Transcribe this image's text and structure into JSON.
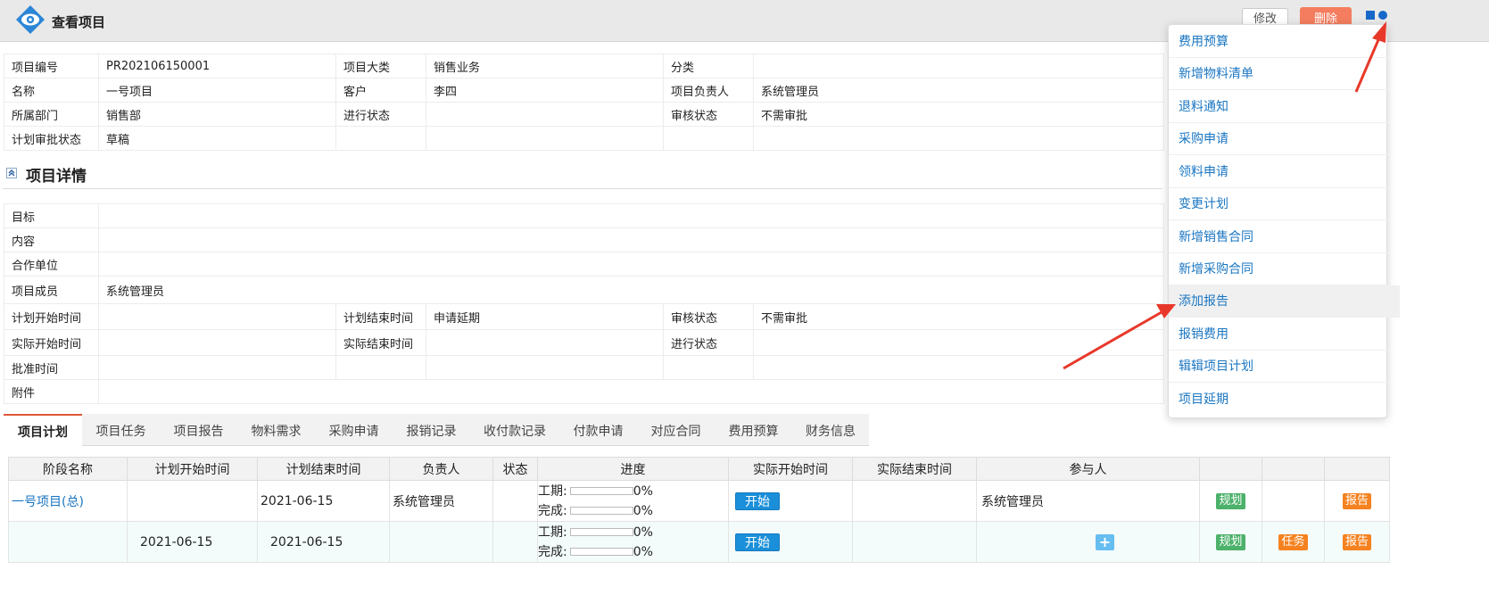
{
  "header": {
    "title": "查看项目",
    "edit_label": "修改",
    "delete_label": "删除"
  },
  "basic_info": {
    "rows": [
      [
        "项目编号",
        "PR202106150001",
        "项目大类",
        "销售业务",
        "分类",
        ""
      ],
      [
        "名称",
        "一号项目",
        "客户",
        "李四",
        "项目负责人",
        "系统管理员"
      ],
      [
        "所属部门",
        "销售部",
        "进行状态",
        "",
        "审核状态",
        "不需审批"
      ],
      [
        "计划审批状态",
        "草稿",
        "",
        "",
        "",
        ""
      ]
    ]
  },
  "detail": {
    "section_title": "项目详情",
    "target_label": "目标",
    "content_label": "内容",
    "partner_label": "合作单位",
    "members_label": "项目成员",
    "members_value": "系统管理员",
    "plan_start_label": "计划开始时间",
    "plan_end_label": "计划结束时间",
    "apply_delay_link": "申请延期",
    "audit_status_label": "审核状态",
    "audit_status_value": "不需审批",
    "actual_start_label": "实际开始时间",
    "actual_end_label": "实际结束时间",
    "progress_status_label": "进行状态",
    "approve_time_label": "批准时间",
    "attachment_label": "附件"
  },
  "tabs": [
    "项目计划",
    "项目任务",
    "项目报告",
    "物料需求",
    "采购申请",
    "报销记录",
    "收付款记录",
    "付款申请",
    "对应合同",
    "费用预算",
    "财务信息"
  ],
  "plan_table": {
    "headers": [
      "阶段名称",
      "计划开始时间",
      "计划结束时间",
      "负责人",
      "状态",
      "进度",
      "实际开始时间",
      "实际结束时间",
      "参与人",
      "",
      "",
      ""
    ],
    "rows": [
      {
        "stage": "一号项目(总)",
        "plan_start": "",
        "plan_end": "2021-06-15",
        "owner": "系统管理员",
        "status": "",
        "work_label": "工期:",
        "work_pct": "0%",
        "done_label": "完成:",
        "done_pct": "0%",
        "start_btn": "开始",
        "participants": "系统管理员",
        "tag_plan": "规划",
        "tag_task": "",
        "tag_report": "报告"
      },
      {
        "stage": "",
        "plan_start": "2021-06-15",
        "plan_end": "2021-06-15",
        "owner": "",
        "status": "",
        "work_label": "工期:",
        "work_pct": "0%",
        "done_label": "完成:",
        "done_pct": "0%",
        "start_btn": "开始",
        "participants": "+",
        "tag_plan": "规划",
        "tag_task": "任务",
        "tag_report": "报告"
      }
    ]
  },
  "dropdown": {
    "items": [
      "费用预算",
      "新增物料清单",
      "退料通知",
      "采购申请",
      "领料申请",
      "变更计划",
      "新增销售合同",
      "新增采购合同",
      "添加报告",
      "报销费用",
      "辑辑项目计划",
      "项目延期"
    ],
    "hovered_item": "添加报告"
  },
  "colors": {
    "link": "#1a76c2",
    "delete_button": "#f47d5f",
    "start_button": "#1b8fd9",
    "tag_green": "#4cb16a",
    "tag_orange": "#f5821f",
    "arrow": "#e8382a"
  },
  "icons": [
    "eye-logo-icon",
    "grid-menu-icon",
    "collapse-icon",
    "plus-icon",
    "arrow-annotation"
  ]
}
